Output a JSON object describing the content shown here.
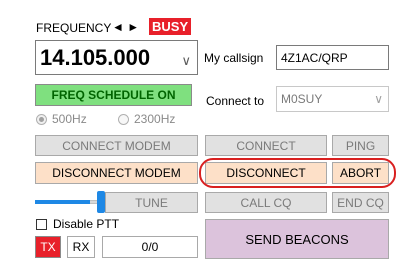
{
  "frequency": {
    "label": "FREQUENCY",
    "arrows": "◄ ►",
    "busy": "BUSY",
    "value": "14.105.000",
    "dropdown_glyph": "∨"
  },
  "callsign": {
    "label": "My callsign",
    "value": "4Z1AC/QRP"
  },
  "freq_schedule": {
    "label": "FREQ SCHEDULE ON"
  },
  "connect_to": {
    "label": "Connect to",
    "value": "M0SUY",
    "dropdown_glyph": "∨"
  },
  "bandwidth": {
    "opt1": "500Hz",
    "opt2": "2300Hz"
  },
  "buttons": {
    "connect_modem": "CONNECT MODEM",
    "connect": "CONNECT",
    "ping": "PING",
    "disconnect_modem": "DISCONNECT MODEM",
    "disconnect": "DISCONNECT",
    "abort": "ABORT",
    "tune": "TUNE",
    "call_cq": "CALL CQ",
    "end_cq": "END CQ",
    "send_beacons": "SEND BEACONS"
  },
  "ptt": {
    "label": "Disable PTT"
  },
  "txrx": {
    "tx": "TX",
    "rx": "RX",
    "counter": "0/0"
  },
  "slider": {
    "level": 0.55
  },
  "colors": {
    "busy": "#e8202a",
    "freq_schedule_bg": "#7fe07f",
    "peach": "#fde0c8",
    "purple": "#dcc3dc",
    "highlight": "#d92020",
    "slider_thumb": "#1e88e5"
  }
}
